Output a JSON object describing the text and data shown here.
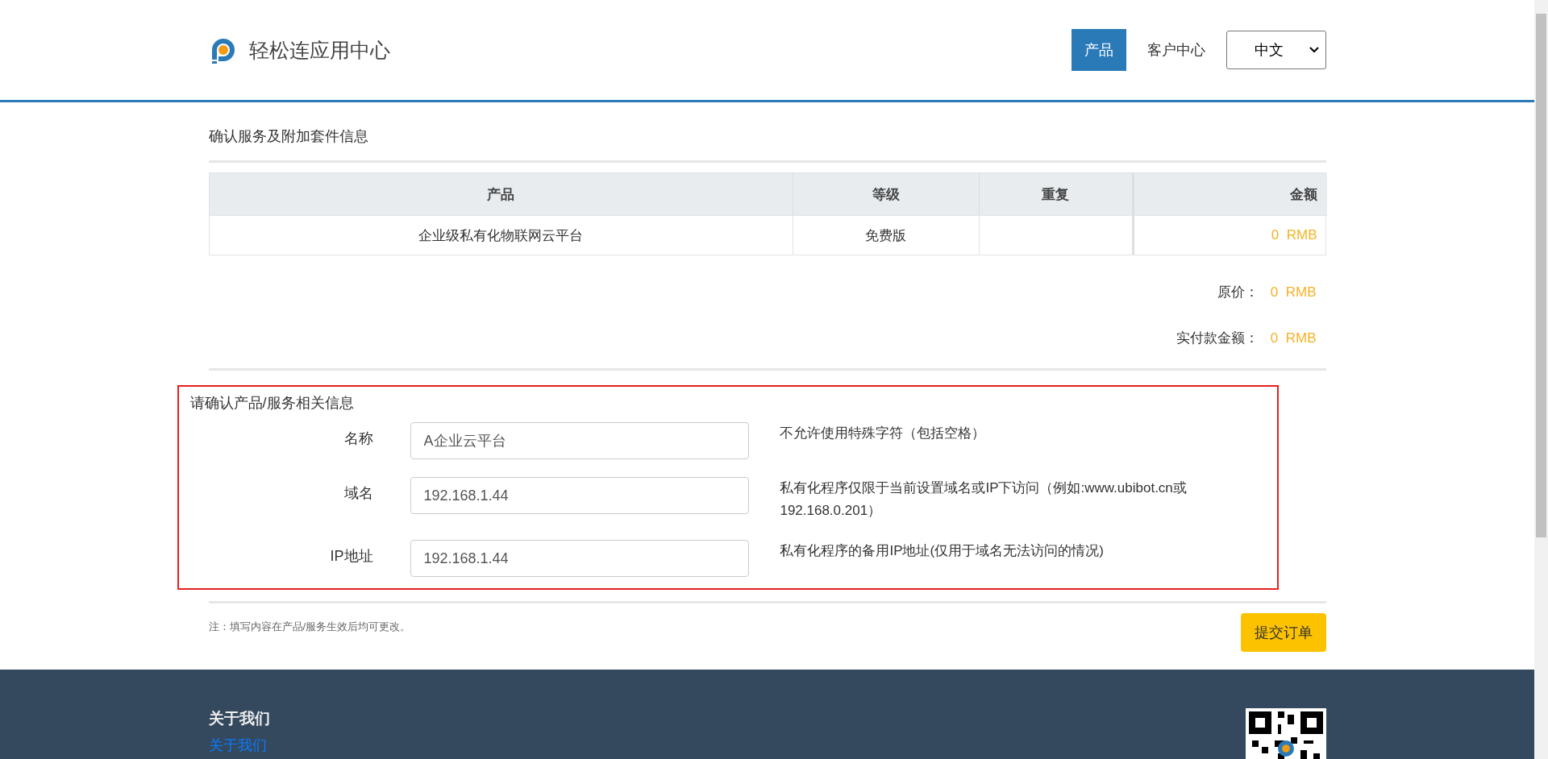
{
  "header": {
    "logo_text": "轻松连应用中心",
    "nav": [
      {
        "label": "产品",
        "selected": true
      },
      {
        "label": "客户中心",
        "selected": false
      }
    ],
    "language": {
      "value": "中文"
    }
  },
  "summary": {
    "title": "确认服务及附加套件信息",
    "table": {
      "columns": [
        "产品",
        "等级",
        "重复",
        "金额"
      ],
      "rows": [
        {
          "cells": [
            "企业级私有化物联网云平台",
            "免费版",
            "",
            "0  RMB"
          ]
        }
      ]
    },
    "totals": [
      {
        "label": "原价：",
        "value": "0  RMB"
      },
      {
        "label": "实付款金额：",
        "value": "0  RMB"
      }
    ]
  },
  "form": {
    "title": "请确认产品/服务相关信息",
    "highlighted": true,
    "fields": [
      {
        "label": "名称",
        "value": "A企业云平台",
        "hint": "不允许使用特殊字符（包括空格）"
      },
      {
        "label": "域名",
        "value": "192.168.1.44",
        "hint": "私有化程序仅限于当前设置域名或IP下访问（例如:www.ubibot.cn或192.168.0.201）"
      },
      {
        "label": "IP地址",
        "value": "192.168.1.44",
        "hint": "私有化程序的备用IP地址(仅用于域名无法访问的情况)"
      }
    ]
  },
  "note": "注：填写内容在产品/服务生效后均可更改。",
  "submit_button": "提交订单",
  "footer": {
    "heading": "关于我们",
    "link": "关于我们"
  }
}
